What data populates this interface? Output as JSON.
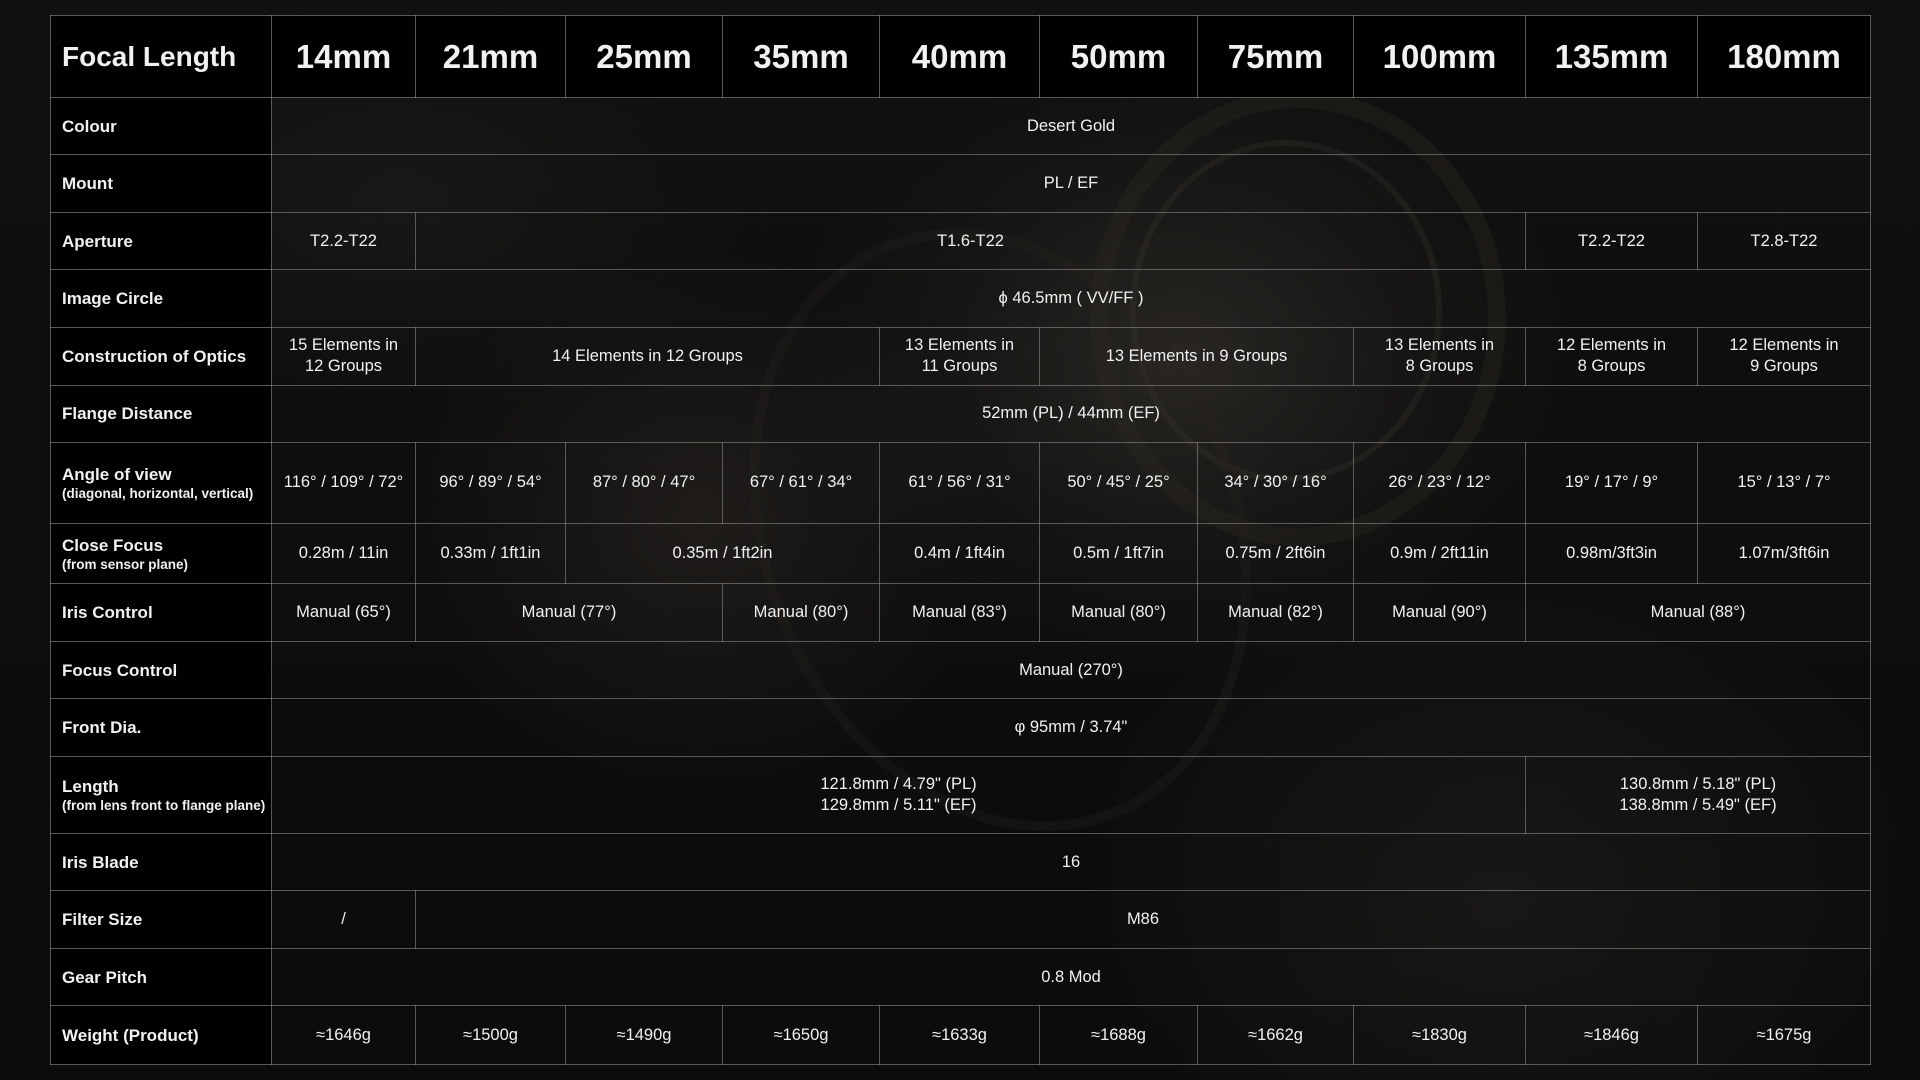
{
  "header": {
    "label": "Focal Length",
    "lenses": [
      "14mm",
      "21mm",
      "25mm",
      "35mm",
      "40mm",
      "50mm",
      "75mm",
      "100mm",
      "135mm",
      "180mm"
    ]
  },
  "rows": {
    "colour": {
      "label": "Colour",
      "value": "Desert Gold"
    },
    "mount": {
      "label": "Mount",
      "value": "PL / EF"
    },
    "aperture": {
      "label": "Aperture",
      "values": [
        "T2.2-T22",
        "T1.6-T22",
        "T2.2-T22",
        "T2.8-T22"
      ]
    },
    "image_circle": {
      "label": "Image Circle",
      "value": "ϕ 46.5mm ( VV/FF )"
    },
    "optics": {
      "label": "Construction of Optics",
      "values": [
        "15 Elements in\n12 Groups",
        "14 Elements in 12 Groups",
        "13 Elements in\n11 Groups",
        "13 Elements in 9 Groups",
        "13 Elements in\n8 Groups",
        "12 Elements in\n8 Groups",
        "12 Elements in\n9 Groups"
      ]
    },
    "flange": {
      "label": "Flange Distance",
      "value": "52mm (PL) / 44mm (EF)"
    },
    "angle": {
      "label": "Angle of view",
      "sublabel": "(diagonal, horizontal, vertical)",
      "values": [
        "116° / 109° / 72°",
        "96° / 89° / 54°",
        "87° / 80° / 47°",
        "67° / 61° / 34°",
        "61° / 56° / 31°",
        "50° / 45° / 25°",
        "34° / 30° / 16°",
        "26° / 23° / 12°",
        "19° / 17° / 9°",
        "15° / 13° / 7°"
      ]
    },
    "close_focus": {
      "label": "Close Focus",
      "sublabel": "(from sensor plane)",
      "values": [
        "0.28m / 11in",
        "0.33m / 1ft1in",
        "0.35m / 1ft2in",
        "0.4m / 1ft4in",
        "0.5m / 1ft7in",
        "0.75m / 2ft6in",
        "0.9m / 2ft11in",
        "0.98m/3ft3in",
        "1.07m/3ft6in"
      ]
    },
    "iris_control": {
      "label": "Iris Control",
      "values": [
        "Manual (65°)",
        "Manual (77°)",
        "Manual (80°)",
        "Manual (83°)",
        "Manual (80°)",
        "Manual (82°)",
        "Manual (90°)",
        "Manual (88°)"
      ]
    },
    "focus_control": {
      "label": "Focus Control",
      "value": "Manual (270°)"
    },
    "front_dia": {
      "label": "Front Dia.",
      "value": "φ 95mm / 3.74\""
    },
    "length": {
      "label": "Length",
      "sublabel": "(from lens front to flange plane)",
      "values": [
        "121.8mm / 4.79\" (PL)\n129.8mm / 5.11\" (EF)",
        "130.8mm / 5.18\" (PL)\n138.8mm / 5.49\" (EF)"
      ]
    },
    "iris_blade": {
      "label": "Iris Blade",
      "value": "16"
    },
    "filter_size": {
      "label": "Filter Size",
      "values": [
        "/",
        "M86"
      ]
    },
    "gear_pitch": {
      "label": "Gear Pitch",
      "value": "0.8 Mod"
    },
    "weight": {
      "label": "Weight (Product)",
      "values": [
        "≈1646g",
        "≈1500g",
        "≈1490g",
        "≈1650g",
        "≈1633g",
        "≈1688g",
        "≈1662g",
        "≈1830g",
        "≈1846g",
        "≈1675g"
      ]
    }
  }
}
